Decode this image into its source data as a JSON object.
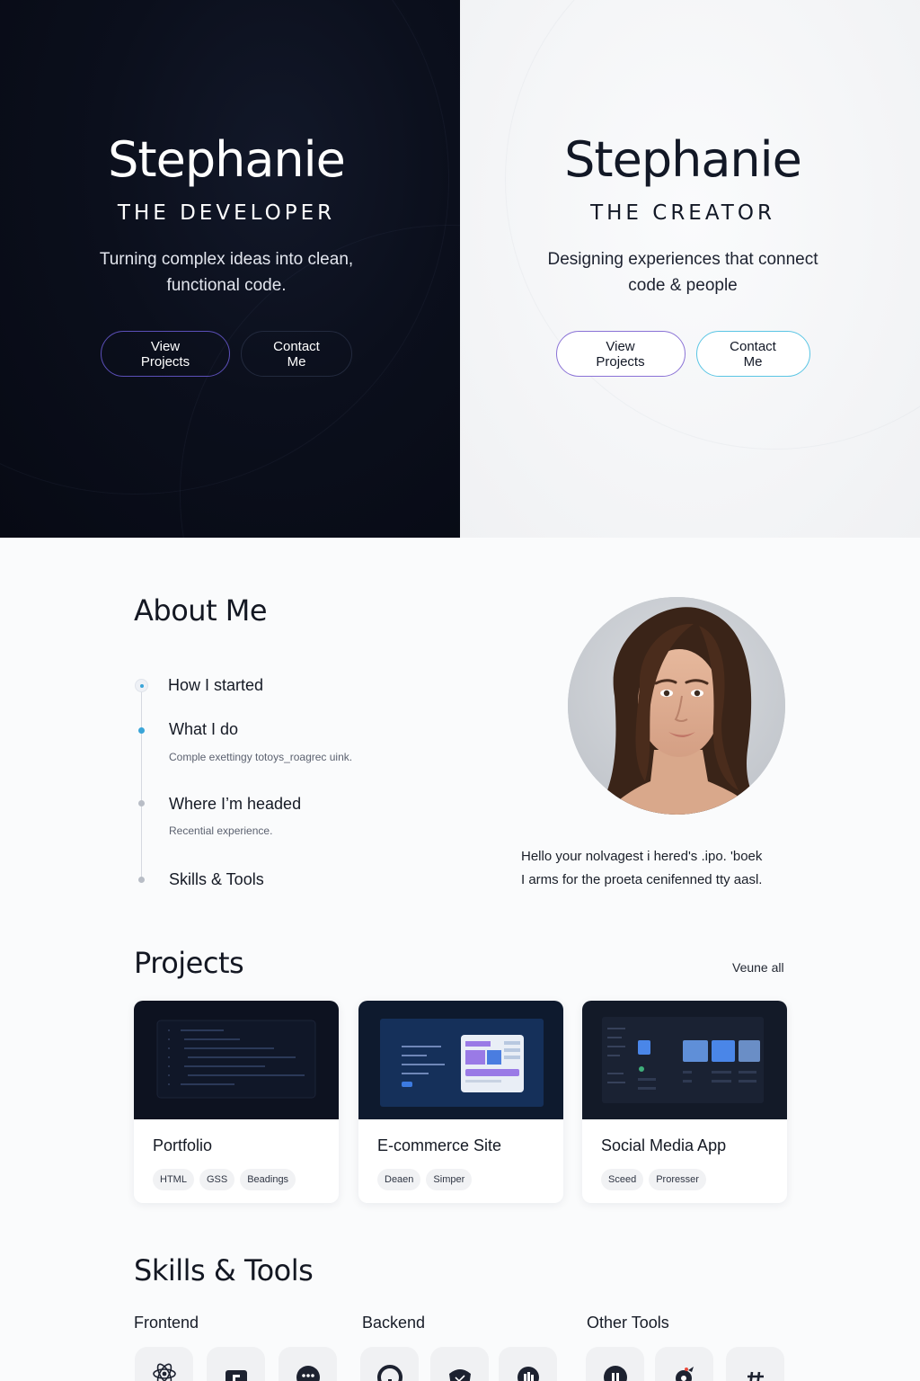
{
  "hero": {
    "developer": {
      "name": "Stephanie",
      "role": "THE DEVELOPER",
      "tagline": "Turning complex ideas into clean, functional code.",
      "primary_button": "View Projects",
      "secondary_button": "Contact Me"
    },
    "creator": {
      "name": "Stephanie",
      "role": "THE CREATOR",
      "tagline": "Designing experiences that connect code & people",
      "primary_button": "View Projects",
      "secondary_button": "Contact Me"
    }
  },
  "about": {
    "title": "About Me",
    "timeline": [
      {
        "title": "How I started",
        "description": ""
      },
      {
        "title": "What I do",
        "description": "Comple exettingy totoys_roagrec uink."
      },
      {
        "title": "Where I’m headed",
        "description": "Recential experience."
      },
      {
        "title": "Skills & Tools",
        "description": ""
      }
    ],
    "bio_line1": "Hello your nolvagest i hered's .ipo. 'boek",
    "bio_line2": "I arms for the proeta cenifenned tty aasl."
  },
  "projects": {
    "title": "Projects",
    "see_all": "Veune all",
    "items": [
      {
        "title": "Portfolio",
        "tags": [
          "HTML",
          "GSS",
          "Beadings"
        ]
      },
      {
        "title": "E-commerce Site",
        "tags": [
          "Deaen",
          "Simper"
        ]
      },
      {
        "title": "Social Media App",
        "tags": [
          "Sceed",
          "Proresser"
        ]
      }
    ]
  },
  "skills": {
    "title": "Skills & Tools",
    "groups": [
      {
        "name": "Frontend",
        "icons": [
          "react-icon",
          "framework-icon",
          "code-bubble-icon"
        ]
      },
      {
        "name": "Backend",
        "icons": [
          "server-ring-icon",
          "api-shield-icon",
          "database-icon"
        ]
      },
      {
        "name": "Other Tools",
        "icons": [
          "tool-circle-icon",
          "bird-icon",
          "hash-icon"
        ]
      }
    ]
  },
  "colors": {
    "dark_bg": "#0b0f1c",
    "light_bg": "#f4f5f7",
    "accent_purple": "#8a72d6",
    "accent_cyan": "#5ac5e4",
    "timeline_accent": "#3aa5d8"
  }
}
